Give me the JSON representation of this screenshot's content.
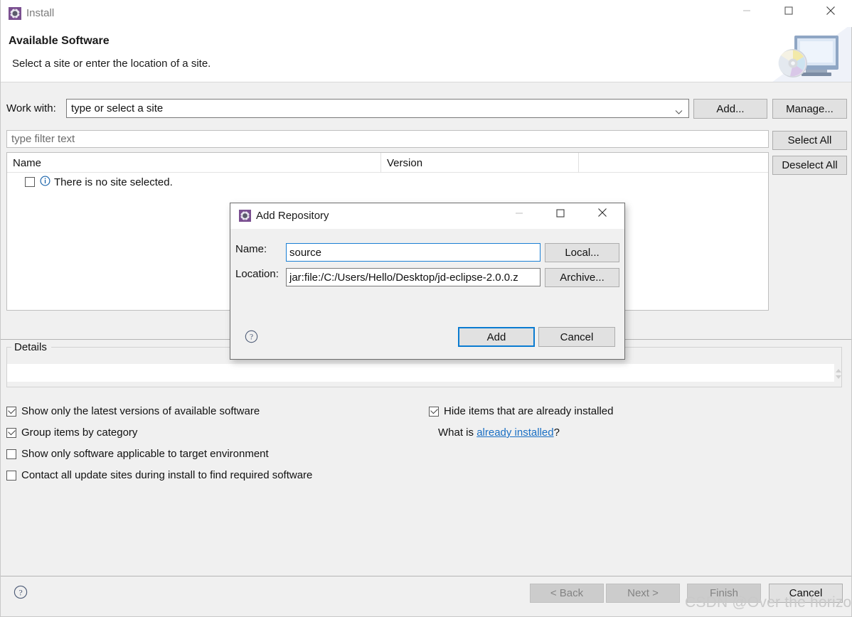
{
  "window": {
    "title": "Install",
    "icon": "eclipse-install-icon",
    "controls": {
      "minimize": "minimize-icon",
      "maximize": "maximize-icon",
      "close": "close-icon"
    }
  },
  "header": {
    "title": "Available Software",
    "subtitle": "Select a site or enter the location of a site.",
    "art_icon": "monitor-cd-icon"
  },
  "work_with": {
    "label": "Work with:",
    "value": "",
    "placeholder": "type or select a site",
    "dropdown_icon": "chevron-down-icon",
    "add_label": "Add...",
    "manage_label": "Manage..."
  },
  "filter": {
    "value": "",
    "placeholder": "type filter text"
  },
  "side_buttons": {
    "select_all": "Select All",
    "deselect_all": "Deselect All"
  },
  "table": {
    "columns": [
      "Name",
      "Version",
      ""
    ],
    "rows": [
      {
        "checked": false,
        "icon": "info-icon",
        "name": "There is no site selected.",
        "version": ""
      }
    ]
  },
  "details": {
    "legend": "Details",
    "value": "",
    "spinner_icon": "spinner-updown-icon"
  },
  "options": [
    {
      "id": "latest-versions",
      "label": "Show only the latest versions of available software",
      "checked": true
    },
    {
      "id": "group-by-category",
      "label": "Group items by category",
      "checked": true
    },
    {
      "id": "target-env",
      "label": "Show only software applicable to target environment",
      "checked": false
    },
    {
      "id": "contact-sites",
      "label": "Contact all update sites during install to find required software",
      "checked": false
    },
    {
      "id": "hide-installed",
      "label": "Hide items that are already installed",
      "checked": true
    }
  ],
  "what_is": {
    "prefix": "What is ",
    "link": "already installed",
    "suffix": "?"
  },
  "footer": {
    "help_icon": "help-icon",
    "back": "< Back",
    "next": "Next >",
    "finish": "Finish",
    "cancel": "Cancel"
  },
  "watermark": "CSDN @Over the horizon",
  "modal": {
    "title": "Add Repository",
    "icon": "eclipse-install-icon",
    "controls": {
      "minimize": "minimize-icon",
      "maximize": "maximize-icon",
      "close": "close-icon"
    },
    "name_label": "Name:",
    "name_value": "source",
    "location_label": "Location:",
    "location_value": "jar:file:/C:/Users/Hello/Desktop/jd-eclipse-2.0.0.z",
    "local_label": "Local...",
    "archive_label": "Archive...",
    "help_icon": "help-icon",
    "add_label": "Add",
    "cancel_label": "Cancel"
  },
  "colors": {
    "accent": "#0a7bd1",
    "link": "#1a6fc4",
    "window_bg": "#f0f0f0",
    "field_bg": "#ffffff"
  }
}
